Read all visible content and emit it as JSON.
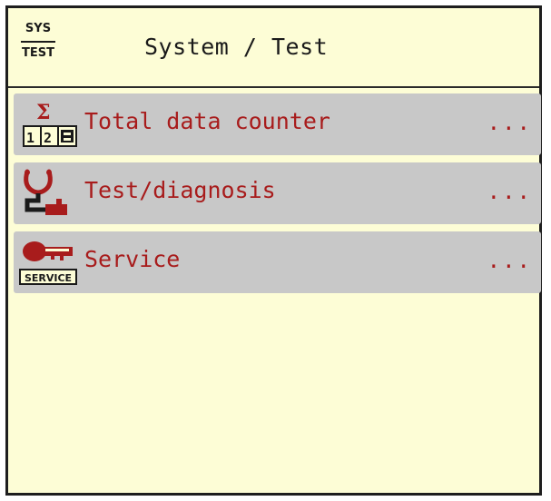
{
  "header": {
    "badge_top": "SYS",
    "badge_bottom": "TEST",
    "title": "System / Test"
  },
  "menu": {
    "items": [
      {
        "label": "Total data counter",
        "more": "...",
        "icon": "total-data-counter-icon"
      },
      {
        "label": "Test/diagnosis",
        "more": "...",
        "icon": "stethoscope-icon"
      },
      {
        "label": "Service",
        "more": "...",
        "icon": "service-key-icon",
        "icon_text": "SERVICE"
      }
    ]
  },
  "colors": {
    "background": "#fdfdd6",
    "item_background": "#c8c8c8",
    "accent": "#a81c1c",
    "text": "#1a1a1a"
  }
}
